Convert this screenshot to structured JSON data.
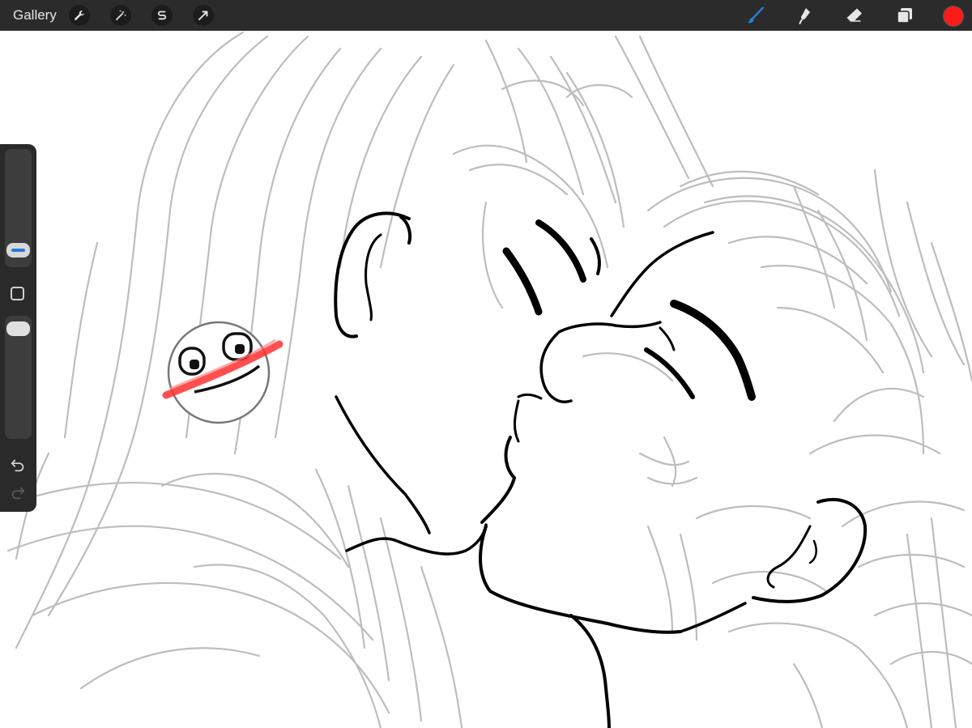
{
  "topbar": {
    "gallery_label": "Gallery",
    "left_tools": [
      {
        "name": "actions",
        "icon": "wrench-icon"
      },
      {
        "name": "adjustments",
        "icon": "magic-wand-icon"
      },
      {
        "name": "selection",
        "icon": "selection-s-icon"
      },
      {
        "name": "transform",
        "icon": "arrow-cursor-icon"
      }
    ],
    "right_tools": [
      {
        "name": "brush",
        "icon": "paintbrush-icon",
        "active": true
      },
      {
        "name": "smudge",
        "icon": "smudge-finger-icon"
      },
      {
        "name": "eraser",
        "icon": "eraser-icon"
      },
      {
        "name": "layers",
        "icon": "layers-icon"
      }
    ],
    "current_color": "#ff1a1a"
  },
  "sidebar": {
    "brush_size_icon": "size-slider-icon",
    "modify_icon": "square-modify-icon",
    "opacity_icon": "opacity-slider-icon",
    "undo_icon": "undo-icon",
    "redo_icon": "redo-icon"
  },
  "colors": {
    "toolbar_bg": "#2b2b2b",
    "sidebar_bg": "#2a2a2a",
    "accent_blue": "#2a7bd6",
    "sketch_gray": "#bdbdbd",
    "ink_black": "#000000",
    "red_stroke": "#ff3030"
  }
}
